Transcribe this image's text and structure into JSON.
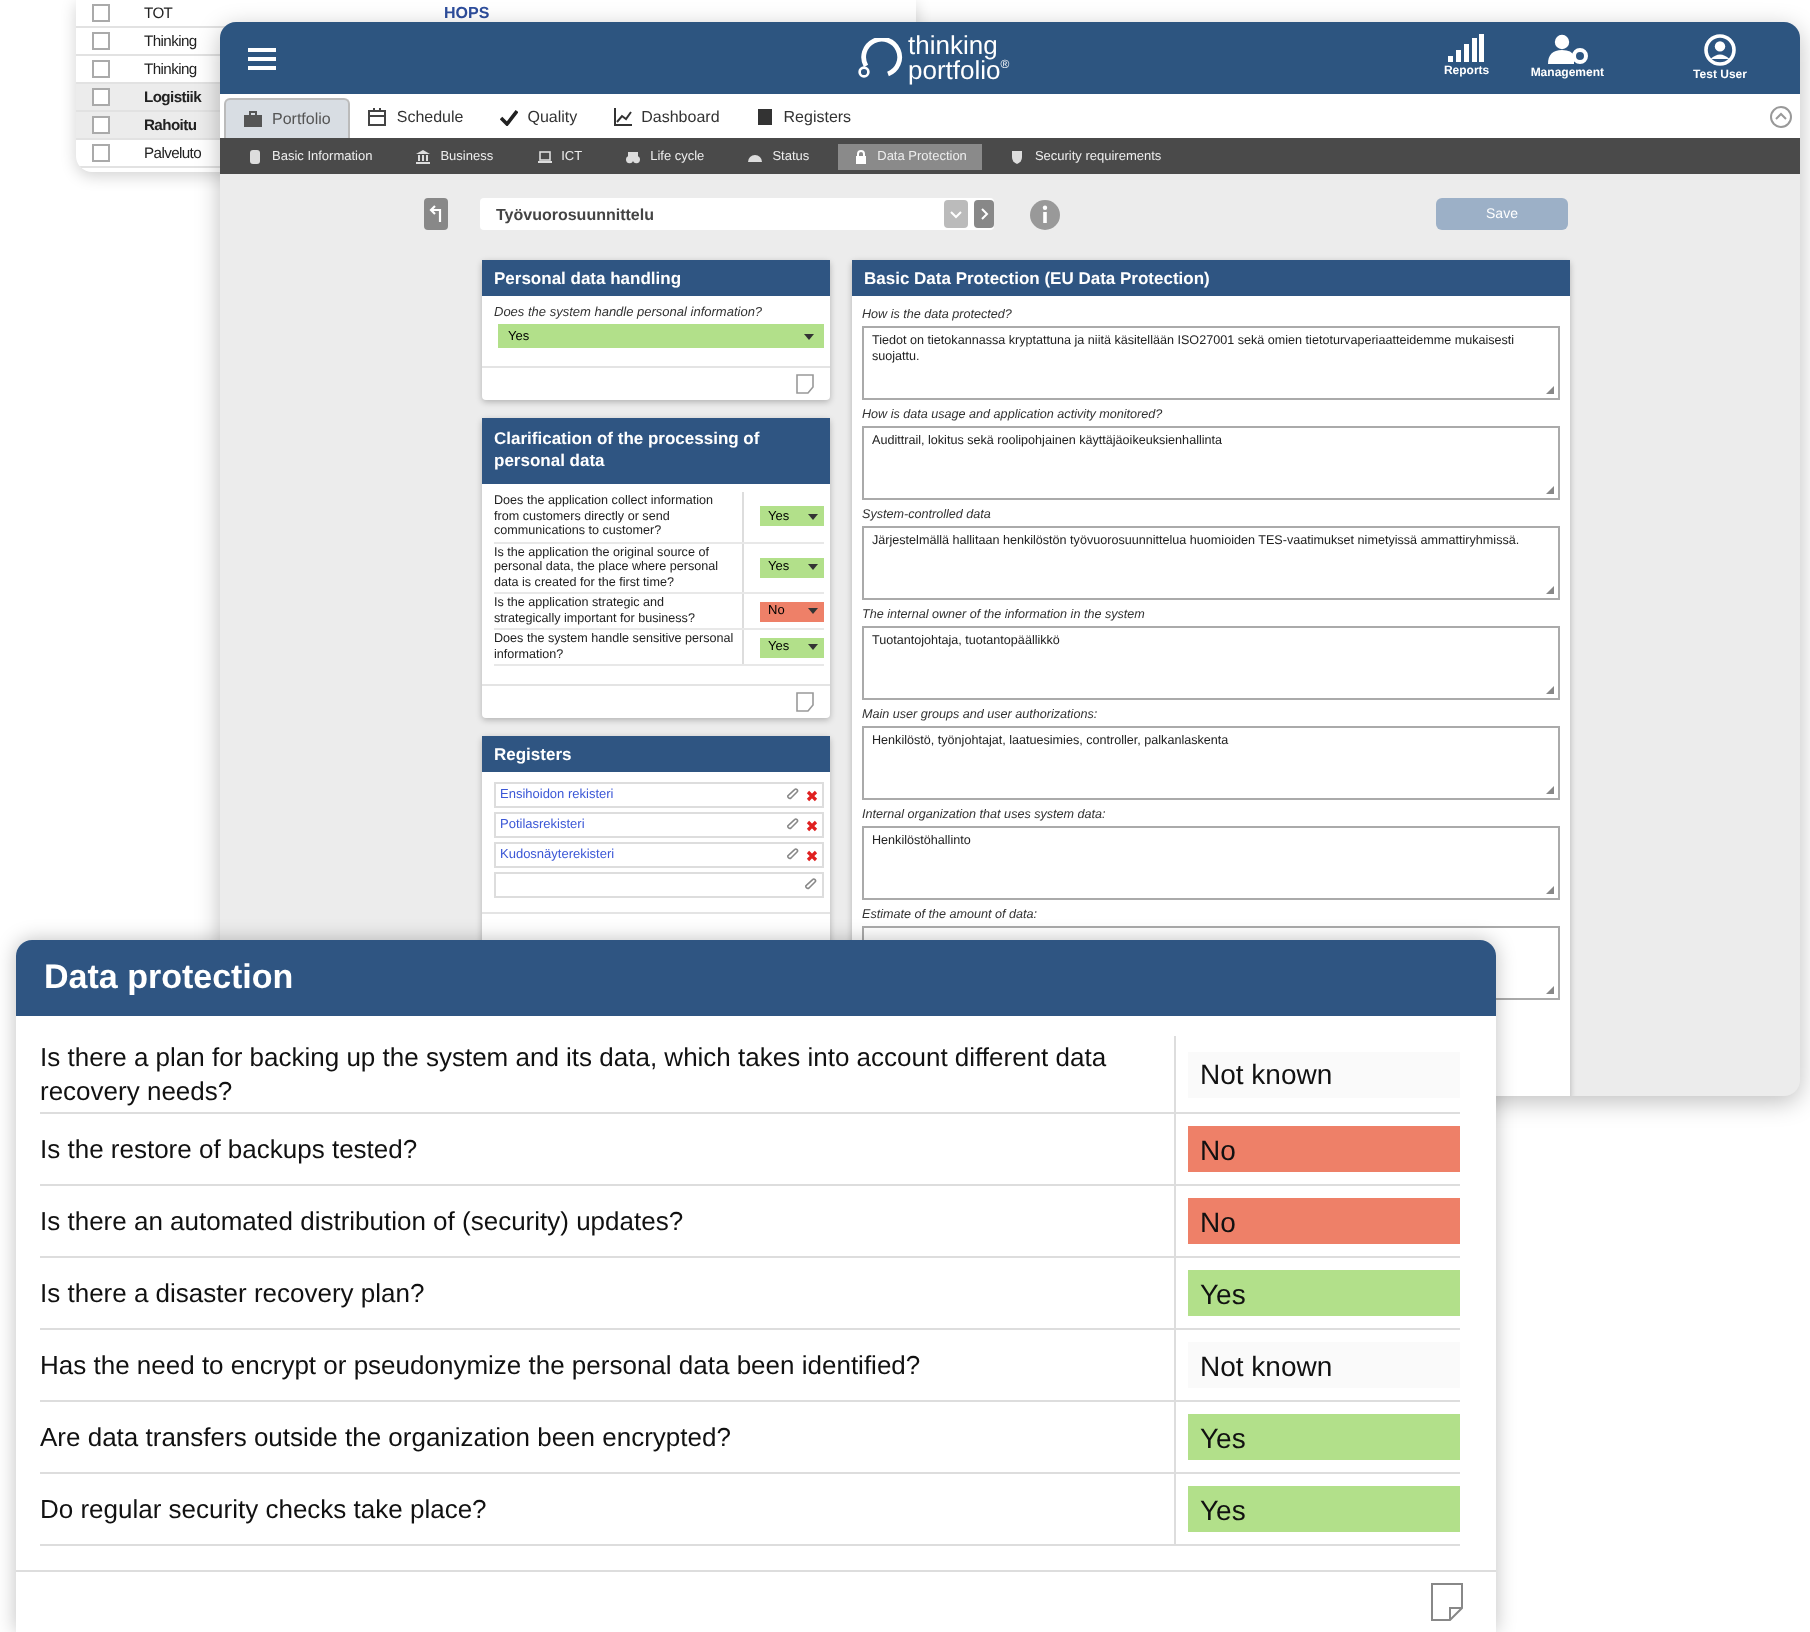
{
  "background_window": {
    "rows": [
      {
        "checked": false,
        "kind": "item",
        "name": "TOT",
        "column_3": "HOPS"
      },
      {
        "checked": false,
        "kind": "item",
        "name": "Thinking"
      },
      {
        "checked": false,
        "kind": "item",
        "name": "Thinking"
      },
      {
        "checked": false,
        "kind": "group",
        "name": "Logistiik"
      },
      {
        "checked": false,
        "kind": "group",
        "name": "Rahoitu"
      },
      {
        "checked": false,
        "kind": "item",
        "name": "Palveluto"
      }
    ]
  },
  "app": {
    "header": {
      "logo": {
        "line_1": "thinking",
        "line_2": "portfolio",
        "mark": "®"
      },
      "actions": [
        {
          "kind": "reports",
          "label": "Reports"
        },
        {
          "kind": "management",
          "label": "Management"
        },
        {
          "kind": "user",
          "label": "Test User"
        }
      ]
    },
    "tabs": [
      {
        "kind": "briefcase",
        "label": "Portfolio",
        "selected": true
      },
      {
        "kind": "calendar",
        "label": "Schedule",
        "selected": false
      },
      {
        "kind": "check",
        "label": "Quality",
        "selected": false
      },
      {
        "kind": "chart",
        "label": "Dashboard",
        "selected": false
      },
      {
        "kind": "book",
        "label": "Registers",
        "selected": false
      }
    ],
    "subtabs": [
      {
        "kind": "database",
        "label": "Basic Information",
        "selected": false
      },
      {
        "kind": "bank",
        "label": "Business",
        "selected": false
      },
      {
        "kind": "laptop",
        "label": "ICT",
        "selected": false
      },
      {
        "kind": "binoculars",
        "label": "Life cycle",
        "selected": false
      },
      {
        "kind": "gauge",
        "label": "Status",
        "selected": false
      },
      {
        "kind": "lock",
        "label": "Data Protection",
        "selected": true
      },
      {
        "kind": "shield",
        "label": "Security requirements",
        "selected": false
      }
    ],
    "record": {
      "value": "Työvuorosuunnittelu"
    },
    "save_button": "Save",
    "personal_data_handling": {
      "title": "Personal data handling",
      "question": "Does the system handle personal information?",
      "answer": {
        "value": "Yes",
        "color": "#b2e08a"
      }
    },
    "clarification": {
      "title": "Clarification of the processing of personal data",
      "rows": [
        {
          "question": "Does the application collect information from customers directly or send communications to customer?",
          "answer": "Yes",
          "color": "#b2e08a"
        },
        {
          "question": "Is the application the original source of personal data, the place where personal data is created for the first time?",
          "answer": "Yes",
          "color": "#b2e08a"
        },
        {
          "question": "Is the application strategic and strategically important for business?",
          "answer": "No",
          "color": "#ee8068"
        },
        {
          "question": "Does the system handle sensitive personal information?",
          "answer": "Yes",
          "color": "#b2e08a"
        }
      ]
    },
    "registers": {
      "title": "Registers",
      "items": [
        "Ensihoidon rekisteri",
        "Potilasrekisteri",
        "Kudosnäyterekisteri"
      ]
    },
    "basic_protection": {
      "title": "Basic Data Protection (EU Data Protection)",
      "fields": [
        {
          "label": "How is the data protected?",
          "value": "Tiedot on tietokannassa kryptattuna ja niitä käsitellään ISO27001 sekä omien tietoturvaperiaatteidemme mukaisesti suojattu."
        },
        {
          "label": "How is data usage and application activity monitored?",
          "value": "Audittrail, lokitus sekä roolipohjainen käyttäjäoikeuksienhallinta"
        },
        {
          "label": "System-controlled data",
          "value": "Järjestelmällä hallitaan henkilöstön työvuorosuunnittelua huomioiden TES-vaatimukset nimetyissä ammattiryhmissä."
        },
        {
          "label": "The internal owner of the information in the system",
          "value": "Tuotantojohtaja, tuotantopäällikkö"
        },
        {
          "label": "Main user groups and user authorizations:",
          "value": "Henkilöstö, työnjohtajat, laatuesimies, controller, palkanlaskenta"
        },
        {
          "label": "Internal organization that uses system data:",
          "value": "Henkilöstöhallinto"
        },
        {
          "label": "Estimate of the amount of data:"
        }
      ]
    }
  },
  "data_protection_card": {
    "title": "Data protection",
    "rows": [
      {
        "question": "Is there a plan for backing up the system and its data, which takes into account different data recovery needs?",
        "answer": "Not known",
        "color": "#fafafa"
      },
      {
        "question": "Is the restore of backups tested?",
        "answer": "No",
        "color": "#ee8068"
      },
      {
        "question": "Is there an automated distribution of (security) updates?",
        "answer": "No",
        "color": "#ee8068"
      },
      {
        "question": "Is there a disaster recovery plan?",
        "answer": "Yes",
        "color": "#b2e08a"
      },
      {
        "question": "Has the need to encrypt or pseudonymize the personal data been identified?",
        "answer": "Not known",
        "color": "#fafafa"
      },
      {
        "question": "Are data transfers outside the organization been encrypted?",
        "answer": "Yes",
        "color": "#b2e08a"
      },
      {
        "question": "Do regular security checks take place?",
        "answer": "Yes",
        "color": "#b2e08a"
      }
    ]
  }
}
